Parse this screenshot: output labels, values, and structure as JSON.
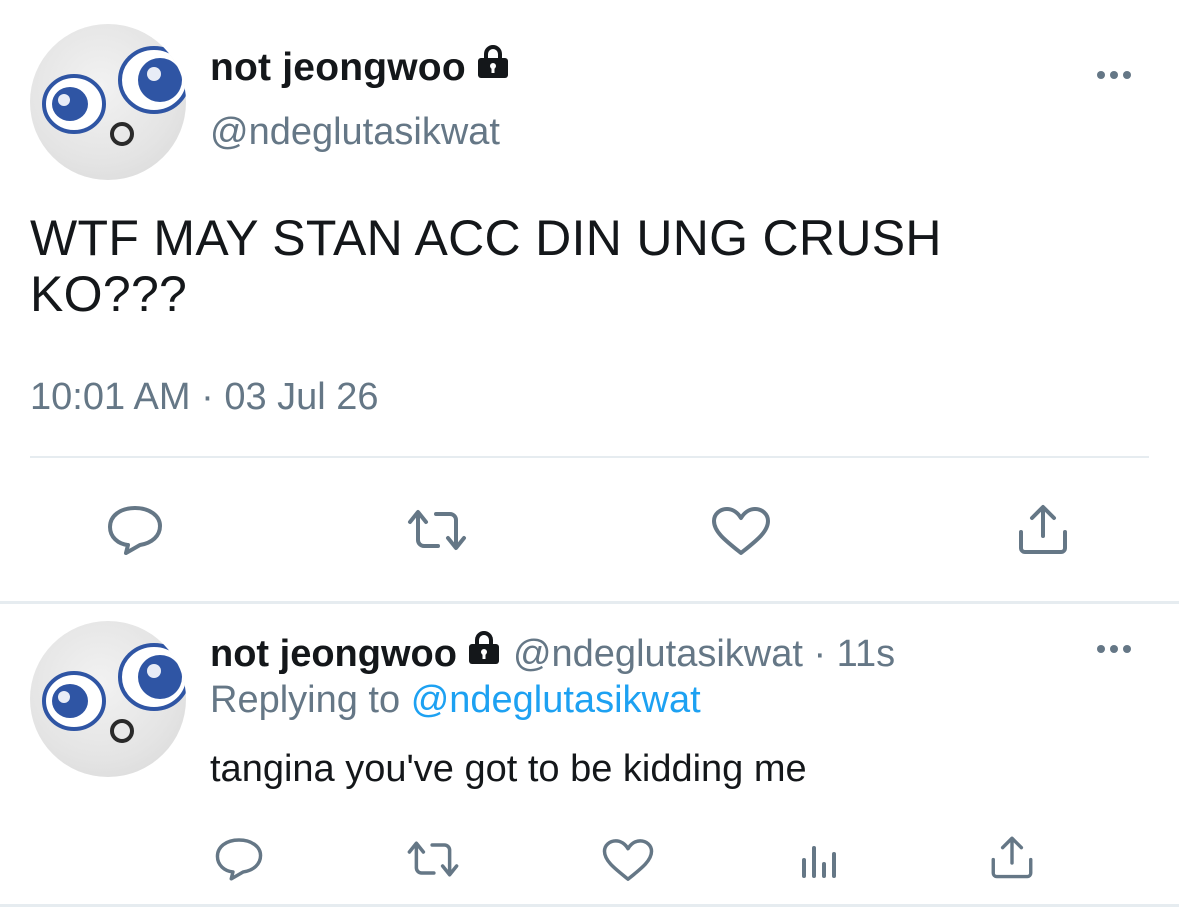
{
  "main_tweet": {
    "display_name": "not jeongwoo",
    "handle": "@ndeglutasikwat",
    "text": "WTF MAY STAN ACC DIN UNG CRUSH KO???",
    "timestamp": "10:01 AM · 03 Jul 26",
    "icons": [
      "lock-icon",
      "more-icon",
      "reply-icon",
      "retweet-icon",
      "like-icon",
      "share-icon"
    ]
  },
  "reply_tweet": {
    "display_name": "not jeongwoo",
    "handle_time": "@ndeglutasikwat · 11s",
    "replying_prefix": "Replying to",
    "replying_to": "@ndeglutasikwat",
    "text": "tangina you've got to be kidding me",
    "icons": [
      "lock-icon",
      "more-icon",
      "reply-icon",
      "retweet-icon",
      "like-icon",
      "analytics-icon",
      "share-icon"
    ]
  },
  "colors": {
    "text": "#14171a",
    "secondary": "#657786",
    "link": "#1da1f2",
    "divider": "#e6ecf0",
    "avatar_accent": "#2f55a4"
  }
}
